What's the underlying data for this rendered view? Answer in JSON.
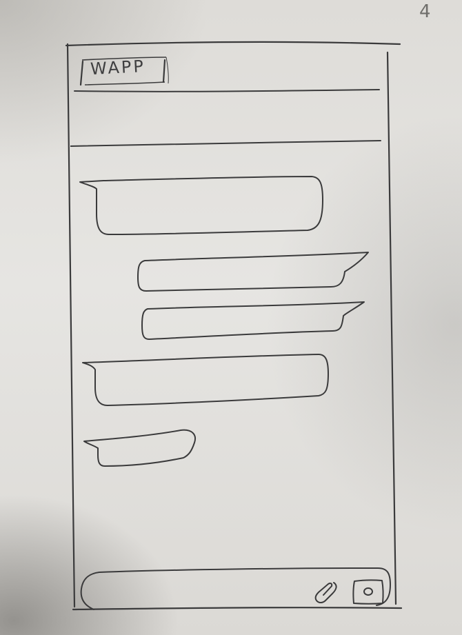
{
  "sheet": {
    "page_number": "4"
  },
  "app_bar": {
    "logo_text": "WAPP"
  },
  "messages": [
    {
      "direction": "incoming"
    },
    {
      "direction": "outgoing"
    },
    {
      "direction": "outgoing"
    },
    {
      "direction": "incoming"
    },
    {
      "direction": "incoming"
    }
  ],
  "composer": {
    "attach_icon": "paperclip-icon",
    "camera_icon": "camera-icon"
  },
  "colors": {
    "paper": "#e4e3e0",
    "pencil": "#3a3a3b"
  }
}
